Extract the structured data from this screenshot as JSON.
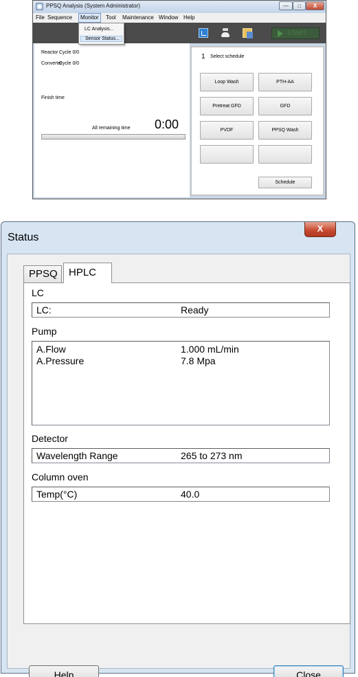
{
  "app": {
    "title": "PPSQ Analysis (System Administrator)",
    "window_controls": {
      "minimize": "—",
      "maximize": "□",
      "close": "X"
    },
    "menu": [
      "File",
      "Sequence",
      "Monitor",
      "Tool",
      "Maintenance",
      "Window",
      "Help"
    ],
    "monitor_menu": [
      "LC Analysis...",
      "Sensor Status..."
    ],
    "toolbar": {
      "start_label": "START"
    },
    "left": {
      "reactor_label": "Reactor",
      "reactor_value": "Cycle 0/0",
      "converter_label": "Converter",
      "converter_value": "Cycle 0/0",
      "finish_time_label": "Finish time",
      "remaining_label": "All remaining time",
      "remaining_value": "0:00"
    },
    "right": {
      "schedule_number": "1",
      "select_schedule_label": "Select schedule",
      "buttons": [
        "Loop Wash",
        "PTH-AA",
        "Pretreat GFD",
        "GFD",
        "PVDF",
        "PPSQ Wash",
        "",
        ""
      ],
      "schedule_button": "Schedule"
    }
  },
  "dialog": {
    "title": "Status",
    "close_glyph": "X",
    "tabs": [
      "PPSQ",
      "HPLC"
    ],
    "active_tab": "HPLC",
    "lc": {
      "title": "LC",
      "rows": [
        {
          "key": "LC:",
          "value": "Ready"
        }
      ]
    },
    "pump": {
      "title": "Pump",
      "rows": [
        {
          "key": "A.Flow",
          "value": "1.000 mL/min"
        },
        {
          "key": "A.Pressure",
          "value": "7.8 Mpa"
        }
      ]
    },
    "detector": {
      "title": "Detector",
      "rows": [
        {
          "key": "Wavelength Range",
          "value": "265 to 273 nm"
        }
      ]
    },
    "column_oven": {
      "title": "Column oven",
      "rows": [
        {
          "key": "Temp(°C)",
          "value": "40.0"
        }
      ]
    },
    "help_button": "Help",
    "close_button": "Close"
  }
}
